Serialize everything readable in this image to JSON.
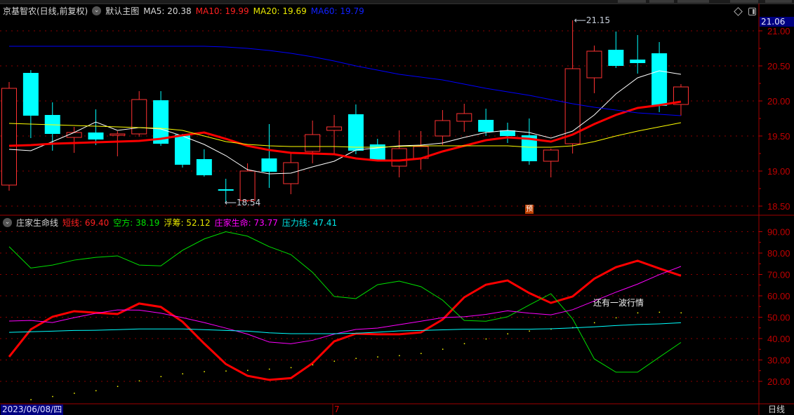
{
  "header": {
    "title": "京基智农(日线,前复权)",
    "template": "默认主图",
    "ma5": "MA5: 20.38",
    "ma10": "MA10: 19.99",
    "ma20": "MA20: 19.69",
    "ma60": "MA60: 19.79"
  },
  "sub_header": {
    "title": "庄家生命线",
    "short": "短线: 69.40",
    "kongfang": "空方: 38.19",
    "fuchou": "浮筹: 52.12",
    "zhuangjia": "庄家生命: 73.77",
    "pressure": "压力线: 47.41"
  },
  "current_price": "21.06",
  "high_label": "21.15",
  "low_label": "18.54",
  "forecast_marker": "预",
  "annotation": "还有一波行情",
  "footer": {
    "date": "2023/06/08/四",
    "month": "7",
    "period": "日线"
  },
  "colors": {
    "up": "#ff3232",
    "down": "#00ffff",
    "ma5": "#ffffff",
    "ma10": "#ff0000",
    "ma20": "#ffff00",
    "ma60": "#0000ff",
    "grid": "#8b0000",
    "axis": "#c00000"
  },
  "chart_data": [
    {
      "type": "candlestick",
      "title": "京基智农(日线,前复权)",
      "ylim": [
        18.5,
        21.06
      ],
      "yticks": [
        "21.00",
        "20.50",
        "20.00",
        "19.50",
        "19.00",
        "18.50"
      ],
      "ytick_values": [
        21.0,
        20.5,
        20.0,
        19.5,
        19.0,
        18.5
      ],
      "ohlc_fields": [
        "open",
        "high",
        "low",
        "close"
      ],
      "candles": [
        [
          18.8,
          20.27,
          18.72,
          20.18
        ],
        [
          20.4,
          20.44,
          19.47,
          19.79
        ],
        [
          19.8,
          19.98,
          19.29,
          19.53
        ],
        [
          19.48,
          19.63,
          19.26,
          19.55
        ],
        [
          19.55,
          19.88,
          19.37,
          19.45
        ],
        [
          19.52,
          19.57,
          19.21,
          19.53
        ],
        [
          19.53,
          20.14,
          19.49,
          20.02
        ],
        [
          20.01,
          20.14,
          19.36,
          19.39
        ],
        [
          19.52,
          19.53,
          19.05,
          19.09
        ],
        [
          19.17,
          19.31,
          18.92,
          18.94
        ],
        [
          18.74,
          18.89,
          18.54,
          18.73
        ],
        [
          18.58,
          19.11,
          18.56,
          19.0
        ],
        [
          19.18,
          19.67,
          18.76,
          18.99
        ],
        [
          18.82,
          19.27,
          18.67,
          19.12
        ],
        [
          19.28,
          19.72,
          19.11,
          19.52
        ],
        [
          19.58,
          19.8,
          19.24,
          19.63
        ],
        [
          19.81,
          19.95,
          19.24,
          19.29
        ],
        [
          19.38,
          19.46,
          19.16,
          19.16
        ],
        [
          19.07,
          19.58,
          18.91,
          19.32
        ],
        [
          19.18,
          19.57,
          19.02,
          19.35
        ],
        [
          19.5,
          19.87,
          19.37,
          19.72
        ],
        [
          19.71,
          19.96,
          19.56,
          19.82
        ],
        [
          19.73,
          19.89,
          19.5,
          19.56
        ],
        [
          19.58,
          19.69,
          19.4,
          19.5
        ],
        [
          19.51,
          19.75,
          19.09,
          19.14
        ],
        [
          19.14,
          19.32,
          18.91,
          19.3
        ],
        [
          19.39,
          21.15,
          19.25,
          20.46
        ],
        [
          20.33,
          20.79,
          20.11,
          20.71
        ],
        [
          20.73,
          20.99,
          20.47,
          20.5
        ],
        [
          20.59,
          20.94,
          20.39,
          20.54
        ],
        [
          20.68,
          20.84,
          19.84,
          19.93
        ],
        [
          19.95,
          20.24,
          19.79,
          20.2
        ]
      ],
      "series": [
        {
          "name": "MA5",
          "color": "#ffffff",
          "values": [
            19.31,
            19.29,
            19.42,
            19.55,
            19.7,
            19.58,
            19.62,
            19.6,
            19.5,
            19.38,
            19.22,
            19.02,
            18.96,
            18.97,
            19.06,
            19.14,
            19.3,
            19.33,
            19.36,
            19.37,
            19.4,
            19.48,
            19.55,
            19.58,
            19.55,
            19.47,
            19.57,
            19.8,
            20.1,
            20.33,
            20.43,
            20.38
          ]
        },
        {
          "name": "MA10",
          "color": "#ff0000",
          "values": [
            19.36,
            19.37,
            19.39,
            19.4,
            19.41,
            19.42,
            19.43,
            19.46,
            19.51,
            19.55,
            19.46,
            19.36,
            19.3,
            19.26,
            19.25,
            19.24,
            19.18,
            19.15,
            19.15,
            19.18,
            19.28,
            19.36,
            19.44,
            19.48,
            19.46,
            19.42,
            19.52,
            19.67,
            19.8,
            19.9,
            19.94,
            19.99
          ]
        },
        {
          "name": "MA20",
          "color": "#ffff00",
          "values": [
            19.68,
            19.67,
            19.66,
            19.65,
            19.64,
            19.63,
            19.62,
            19.61,
            19.58,
            19.5,
            19.42,
            19.38,
            19.36,
            19.35,
            19.35,
            19.35,
            19.34,
            19.34,
            19.35,
            19.36,
            19.36,
            19.36,
            19.36,
            19.36,
            19.34,
            19.34,
            19.36,
            19.42,
            19.5,
            19.57,
            19.63,
            19.69
          ]
        },
        {
          "name": "MA60",
          "color": "#0000ff",
          "values": [
            20.78,
            20.78,
            20.78,
            20.78,
            20.78,
            20.78,
            20.78,
            20.78,
            20.78,
            20.78,
            20.77,
            20.75,
            20.72,
            20.68,
            20.63,
            20.57,
            20.5,
            20.44,
            20.38,
            20.34,
            20.3,
            20.24,
            20.18,
            20.13,
            20.08,
            20.02,
            19.96,
            19.91,
            19.87,
            19.83,
            19.81,
            19.79
          ]
        }
      ]
    },
    {
      "type": "line",
      "title": "庄家生命线",
      "ylim": [
        20,
        90
      ],
      "yticks": [
        "90.00",
        "80.00",
        "70.00",
        "60.00",
        "50.00",
        "40.00",
        "30.00",
        "20.00"
      ],
      "ytick_values": [
        90,
        80,
        70,
        60,
        50,
        40,
        30,
        20
      ],
      "series": [
        {
          "name": "短线",
          "color": "#ff0000",
          "style": "thick",
          "values": [
            31.5,
            44.3,
            50.2,
            52.8,
            52.1,
            51.5,
            56.4,
            54.8,
            47.9,
            37.7,
            28.1,
            22.6,
            20.7,
            21.5,
            28.5,
            38.7,
            42.3,
            42.0,
            42.0,
            42.9,
            48.9,
            59.3,
            65.2,
            67.2,
            61.3,
            56.7,
            59.7,
            68.0,
            73.4,
            76.4,
            72.8,
            69.4
          ]
        },
        {
          "name": "空方",
          "color": "#00e000",
          "style": "line",
          "values": [
            83.0,
            73.0,
            74.4,
            76.7,
            78.0,
            78.7,
            74.4,
            74.0,
            81.3,
            86.6,
            90.0,
            87.9,
            83.0,
            79.3,
            71.0,
            59.7,
            58.7,
            65.2,
            66.9,
            64.3,
            58.0,
            48.5,
            48.1,
            50.2,
            55.7,
            61.0,
            49.2,
            30.5,
            24.3,
            24.3,
            31.3,
            38.19
          ]
        },
        {
          "name": "浮筹",
          "color": "#ffff00",
          "style": "dots",
          "values": [
            10.0,
            11.5,
            13.0,
            14.5,
            15.7,
            17.7,
            20.3,
            22.3,
            23.6,
            24.6,
            24.9,
            25.2,
            25.8,
            26.5,
            27.8,
            29.5,
            30.8,
            31.5,
            32.1,
            33.1,
            35.1,
            37.7,
            39.9,
            42.3,
            43.6,
            44.5,
            45.2,
            47.5,
            49.8,
            52.1,
            52.4,
            52.12
          ]
        },
        {
          "name": "庄家生命",
          "color": "#ff00ff",
          "style": "line",
          "values": [
            48.2,
            48.5,
            47.5,
            49.8,
            51.8,
            53.4,
            53.3,
            51.9,
            49.8,
            47.5,
            44.9,
            42.1,
            38.4,
            37.6,
            39.2,
            42.1,
            44.3,
            44.9,
            46.5,
            48.1,
            49.8,
            50.2,
            51.3,
            53.0,
            51.9,
            51.1,
            53.5,
            57.6,
            61.7,
            65.5,
            69.9,
            73.77
          ]
        },
        {
          "name": "压力线",
          "color": "#00ffff",
          "style": "line",
          "values": [
            42.9,
            43.2,
            43.5,
            43.8,
            43.9,
            44.2,
            44.5,
            44.5,
            44.5,
            44.2,
            43.8,
            43.5,
            42.7,
            42.3,
            42.3,
            42.3,
            42.5,
            43.0,
            43.6,
            43.8,
            44.1,
            44.4,
            44.4,
            44.4,
            44.4,
            44.6,
            45.0,
            45.5,
            46.1,
            46.6,
            46.9,
            47.41
          ]
        }
      ]
    }
  ]
}
